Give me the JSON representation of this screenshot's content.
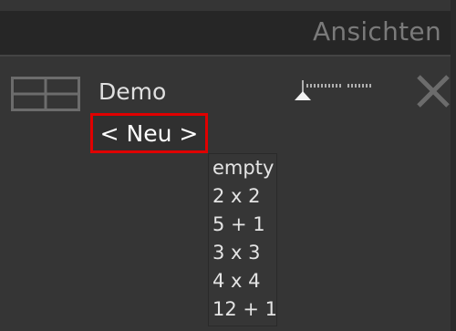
{
  "header": {
    "title": "Ansichten"
  },
  "layout": {
    "name": "Demo",
    "new_label": "< Neu >",
    "icon": "grid-2x2-icon",
    "slider_icon": "zoom-slider",
    "close_icon": "close-icon"
  },
  "dropdown": {
    "items": [
      {
        "label": "empty"
      },
      {
        "label": "2 x 2"
      },
      {
        "label": "5 + 1"
      },
      {
        "label": "3 x 3"
      },
      {
        "label": "4 x 4"
      },
      {
        "label": "12 + 1"
      }
    ]
  },
  "colors": {
    "background": "#353535",
    "header_bg": "#262626",
    "highlight_border": "#e00000",
    "text": "#e0e0e0"
  }
}
